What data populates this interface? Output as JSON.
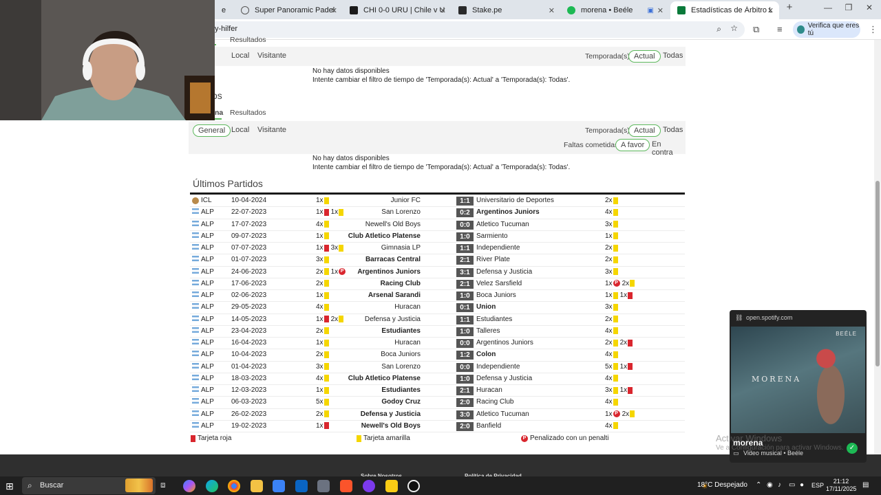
{
  "browser": {
    "tabs": [
      {
        "label": "el",
        "color": "#888888"
      },
      {
        "label": "Super Panoramic Padel Court",
        "color": "#555555"
      },
      {
        "label": "CHI 0-0 URU | Chile v Uruguay",
        "color": "#1a1a1a"
      },
      {
        "label": "Stake.pe",
        "color": "#2a2a2a"
      },
      {
        "label": "morena • Beéle",
        "color": "#1db954"
      },
      {
        "label": "Estadísticas de Árbitro Leandro",
        "color": "#0a7a3a"
      }
    ],
    "new_tab": "+",
    "minimize": "—",
    "restore": "❐",
    "close": "✕",
    "address": "y-hilfer",
    "verify_chip": "Verifica que eres tú",
    "zoom_icon": "zoom-icon",
    "star_icon": "star-icon"
  },
  "section1": {
    "tab_general_partial": "al",
    "tab_local": "Local",
    "tab_visitante": "Visitante",
    "temporada_label": "Temporada(s):",
    "temporada_actual": "Actual",
    "temporada_todas": "Todas",
    "nodata1": "No hay datos disponibles",
    "nodata2": "Intente cambiar el filtro de tiempo de 'Temporada(s): Actual' a 'Temporada(s): Todas'.",
    "top_tab_partial": "Resultados"
  },
  "section2": {
    "title_partial": "os",
    "tab_partial": "na",
    "tab_resultados": "Resultados",
    "btn_general": "General",
    "btn_local": "Local",
    "btn_visitante": "Visitante",
    "temporada_label": "Temporada(s):",
    "temporada_actual": "Actual",
    "temporada_todas": "Todas",
    "faltas_label": "Faltas cometidas:",
    "faltas_favor": "A favor",
    "faltas_contra": "En contra",
    "nodata1": "No hay datos disponibles",
    "nodata2": "Intente cambiar el filtro de tiempo de 'Temporada(s): Actual' a 'Temporada(s): Todas'."
  },
  "matches": {
    "title": "Últimos Partidos",
    "rows": [
      {
        "comp": "ICL",
        "date": "10-04-2024",
        "home": "Junior FC",
        "score": "1:1",
        "away": "Universitario de Deportes",
        "winner": "",
        "hcards": [
          {
            "n": "1x",
            "t": "y"
          }
        ],
        "acards": [
          {
            "n": "2x",
            "t": "y"
          }
        ],
        "flag": "ball"
      },
      {
        "comp": "ALP",
        "date": "22-07-2023",
        "home": "San Lorenzo",
        "score": "0:2",
        "away": "Argentinos Juniors",
        "winner": "away",
        "hcards": [
          {
            "n": "1x",
            "t": "r"
          },
          {
            "n": "1x",
            "t": "y"
          }
        ],
        "acards": [
          {
            "n": "4x",
            "t": "y"
          }
        ],
        "flag": "arg"
      },
      {
        "comp": "ALP",
        "date": "17-07-2023",
        "home": "Newell's Old Boys",
        "score": "0:0",
        "away": "Atletico Tucuman",
        "winner": "",
        "hcards": [
          {
            "n": "4x",
            "t": "y"
          }
        ],
        "acards": [
          {
            "n": "3x",
            "t": "y"
          }
        ],
        "flag": "arg"
      },
      {
        "comp": "ALP",
        "date": "09-07-2023",
        "home": "Club Atletico Platense",
        "score": "1:0",
        "away": "Sarmiento",
        "winner": "home",
        "hcards": [
          {
            "n": "1x",
            "t": "y"
          }
        ],
        "acards": [
          {
            "n": "1x",
            "t": "y"
          }
        ],
        "flag": "arg"
      },
      {
        "comp": "ALP",
        "date": "07-07-2023",
        "home": "Gimnasia LP",
        "score": "1:1",
        "away": "Independiente",
        "winner": "",
        "hcards": [
          {
            "n": "1x",
            "t": "r"
          },
          {
            "n": "3x",
            "t": "y"
          }
        ],
        "acards": [
          {
            "n": "2x",
            "t": "y"
          }
        ],
        "flag": "arg"
      },
      {
        "comp": "ALP",
        "date": "01-07-2023",
        "home": "Barracas Central",
        "score": "2:1",
        "away": "River Plate",
        "winner": "home",
        "hcards": [
          {
            "n": "3x",
            "t": "y"
          }
        ],
        "acards": [
          {
            "n": "2x",
            "t": "y"
          }
        ],
        "flag": "arg"
      },
      {
        "comp": "ALP",
        "date": "24-06-2023",
        "home": "Argentinos Juniors",
        "score": "3:1",
        "away": "Defensa y Justicia",
        "winner": "home",
        "hcards": [
          {
            "n": "2x",
            "t": "y"
          },
          {
            "n": "1x",
            "t": "p"
          }
        ],
        "acards": [
          {
            "n": "3x",
            "t": "y"
          }
        ],
        "flag": "arg"
      },
      {
        "comp": "ALP",
        "date": "17-06-2023",
        "home": "Racing Club",
        "score": "2:1",
        "away": "Velez Sarsfield",
        "winner": "home",
        "hcards": [
          {
            "n": "2x",
            "t": "y"
          }
        ],
        "acards": [
          {
            "n": "1x",
            "t": "p"
          },
          {
            "n": "2x",
            "t": "y"
          }
        ],
        "flag": "arg"
      },
      {
        "comp": "ALP",
        "date": "02-06-2023",
        "home": "Arsenal Sarandi",
        "score": "1:0",
        "away": "Boca Juniors",
        "winner": "home",
        "hcards": [
          {
            "n": "1x",
            "t": "y"
          }
        ],
        "acards": [
          {
            "n": "1x",
            "t": "y"
          },
          {
            "n": "1x",
            "t": "r"
          }
        ],
        "flag": "arg"
      },
      {
        "comp": "ALP",
        "date": "29-05-2023",
        "home": "Huracan",
        "score": "0:1",
        "away": "Union",
        "winner": "away",
        "hcards": [
          {
            "n": "4x",
            "t": "y"
          }
        ],
        "acards": [
          {
            "n": "3x",
            "t": "y"
          }
        ],
        "flag": "arg"
      },
      {
        "comp": "ALP",
        "date": "14-05-2023",
        "home": "Defensa y Justicia",
        "score": "1:1",
        "away": "Estudiantes",
        "winner": "",
        "hcards": [
          {
            "n": "1x",
            "t": "r"
          },
          {
            "n": "2x",
            "t": "y"
          }
        ],
        "acards": [
          {
            "n": "2x",
            "t": "y"
          }
        ],
        "flag": "arg"
      },
      {
        "comp": "ALP",
        "date": "23-04-2023",
        "home": "Estudiantes",
        "score": "1:0",
        "away": "Talleres",
        "winner": "home",
        "hcards": [
          {
            "n": "2x",
            "t": "y"
          }
        ],
        "acards": [
          {
            "n": "4x",
            "t": "y"
          }
        ],
        "flag": "arg"
      },
      {
        "comp": "ALP",
        "date": "16-04-2023",
        "home": "Huracan",
        "score": "0:0",
        "away": "Argentinos Juniors",
        "winner": "",
        "hcards": [
          {
            "n": "1x",
            "t": "y"
          }
        ],
        "acards": [
          {
            "n": "2x",
            "t": "y"
          },
          {
            "n": "2x",
            "t": "r"
          }
        ],
        "flag": "arg"
      },
      {
        "comp": "ALP",
        "date": "10-04-2023",
        "home": "Boca Juniors",
        "score": "1:2",
        "away": "Colon",
        "winner": "away",
        "hcards": [
          {
            "n": "2x",
            "t": "y"
          }
        ],
        "acards": [
          {
            "n": "4x",
            "t": "y"
          }
        ],
        "flag": "arg"
      },
      {
        "comp": "ALP",
        "date": "01-04-2023",
        "home": "San Lorenzo",
        "score": "0:0",
        "away": "Independiente",
        "winner": "",
        "hcards": [
          {
            "n": "3x",
            "t": "y"
          }
        ],
        "acards": [
          {
            "n": "5x",
            "t": "y"
          },
          {
            "n": "1x",
            "t": "r"
          }
        ],
        "flag": "arg"
      },
      {
        "comp": "ALP",
        "date": "18-03-2023",
        "home": "Club Atletico Platense",
        "score": "1:0",
        "away": "Defensa y Justicia",
        "winner": "home",
        "hcards": [
          {
            "n": "4x",
            "t": "y"
          }
        ],
        "acards": [
          {
            "n": "4x",
            "t": "y"
          }
        ],
        "flag": "arg"
      },
      {
        "comp": "ALP",
        "date": "12-03-2023",
        "home": "Estudiantes",
        "score": "2:1",
        "away": "Huracan",
        "winner": "home",
        "hcards": [
          {
            "n": "1x",
            "t": "y"
          }
        ],
        "acards": [
          {
            "n": "3x",
            "t": "y"
          },
          {
            "n": "1x",
            "t": "r"
          }
        ],
        "flag": "arg"
      },
      {
        "comp": "ALP",
        "date": "06-03-2023",
        "home": "Godoy Cruz",
        "score": "2:0",
        "away": "Racing Club",
        "winner": "home",
        "hcards": [
          {
            "n": "5x",
            "t": "y"
          }
        ],
        "acards": [
          {
            "n": "4x",
            "t": "y"
          }
        ],
        "flag": "arg"
      },
      {
        "comp": "ALP",
        "date": "26-02-2023",
        "home": "Defensa y Justicia",
        "score": "3:0",
        "away": "Atletico Tucuman",
        "winner": "home",
        "hcards": [
          {
            "n": "2x",
            "t": "y"
          }
        ],
        "acards": [
          {
            "n": "1x",
            "t": "p"
          },
          {
            "n": "2x",
            "t": "y"
          }
        ],
        "flag": "arg"
      },
      {
        "comp": "ALP",
        "date": "19-02-2023",
        "home": "Newell's Old Boys",
        "score": "2:0",
        "away": "Banfield",
        "winner": "home",
        "hcards": [
          {
            "n": "1x",
            "t": "r"
          }
        ],
        "acards": [
          {
            "n": "4x",
            "t": "y"
          }
        ],
        "flag": "arg"
      }
    ]
  },
  "legend": {
    "red": "Tarjeta roja",
    "yellow": "Tarjeta amarilla",
    "penalty": "Penalizado con un penalti",
    "penalty_glyph": "P"
  },
  "footer": {
    "left": "Sobre Nosotros",
    "right": "Política de Privacidad"
  },
  "spotify": {
    "url": "open.spotify.com",
    "brand": "BEÉLE",
    "art_title": "MORENA",
    "track": "morena",
    "subtitle": "Video musical • Beéle"
  },
  "watermark": {
    "line1": "Activar Windows",
    "line2": "Ve a Configuración para activar Windows."
  },
  "taskbar": {
    "search_placeholder": "Buscar",
    "weather": "18°C  Despejado",
    "lang": "ESP",
    "time": "21:12",
    "date": "17/11/2025"
  },
  "colors": {
    "accent_green": "#5cb85c",
    "yellow_card": "#f5d600",
    "red_card": "#d9262e",
    "score_bg": "#555555"
  }
}
